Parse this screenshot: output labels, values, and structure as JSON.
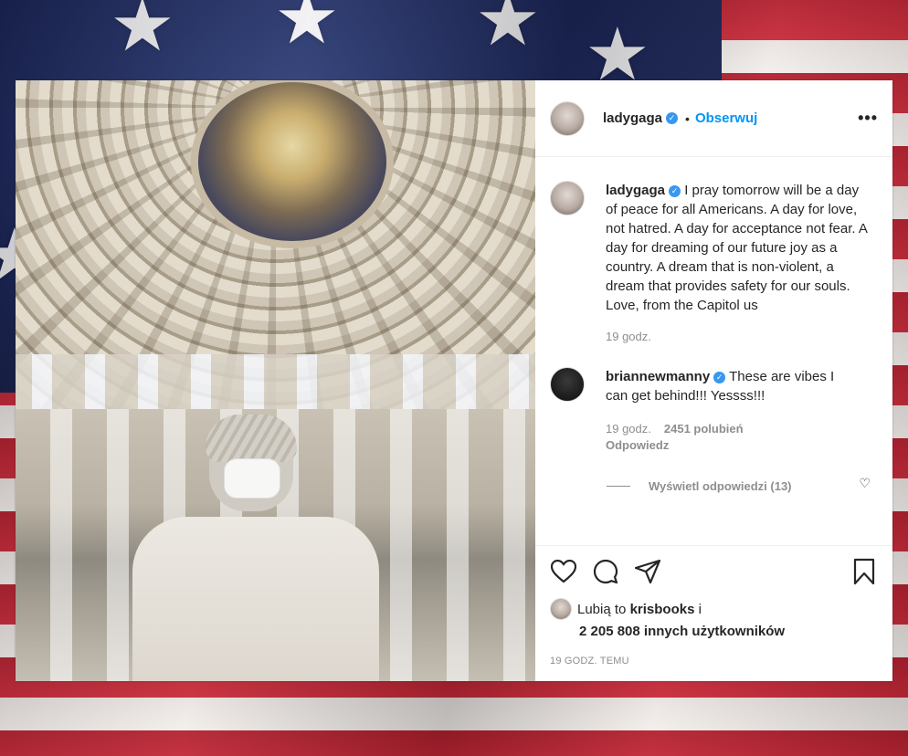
{
  "post": {
    "username": "ladygaga",
    "follow_label": "Obserwuj",
    "caption": "I pray tomorrow will be a day of peace for all Americans. A day for love, not hatred. A day for acceptance not fear. A day for dreaming of our future joy as a country. A dream that is non-violent, a dream that provides safety for our souls. Love, from the Capitol us",
    "caption_time": "19 godz."
  },
  "comment": {
    "username": "briannewmanny",
    "text": "These are vibes I can get behind!!! Yessss!!!",
    "time": "19 godz.",
    "likes": "2451 polubień",
    "reply_label": "Odpowiedz",
    "view_replies": "Wyświetl odpowiedzi (13)"
  },
  "likes": {
    "prefix": "Lubią to",
    "user": "krisbooks",
    "suffix": "i",
    "count_text": "2 205 808 innych użytkowników"
  },
  "timestamp": "19 GODZ. TEMU",
  "icons": {
    "verified": "verified-badge-icon",
    "more": "more-options-icon",
    "like": "heart-icon",
    "comment": "comment-bubble-icon",
    "share": "paper-plane-icon",
    "save": "bookmark-icon"
  },
  "colors": {
    "accent": "#0095f6",
    "verified": "#3897f0",
    "text": "#262626",
    "muted": "#8e8e8e"
  }
}
